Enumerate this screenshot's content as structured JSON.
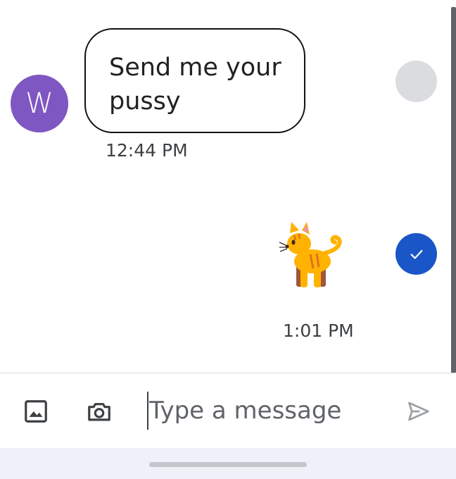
{
  "conversation": {
    "incoming": {
      "avatar_initial": "W",
      "text": "Send me your\npussy",
      "time": "12:44 PM"
    },
    "outgoing": {
      "emoji": "cat",
      "time": "1:01 PM",
      "status": "sent"
    }
  },
  "composer": {
    "placeholder": "Type a message",
    "value": ""
  },
  "icons": {
    "gallery": "image-icon",
    "camera": "camera-icon",
    "send": "send-icon",
    "check": "check-icon"
  },
  "colors": {
    "avatar": "#7e57c2",
    "sent_status": "#1a56c7",
    "pending_status": "#dadce0",
    "cat": "#ffb300"
  }
}
